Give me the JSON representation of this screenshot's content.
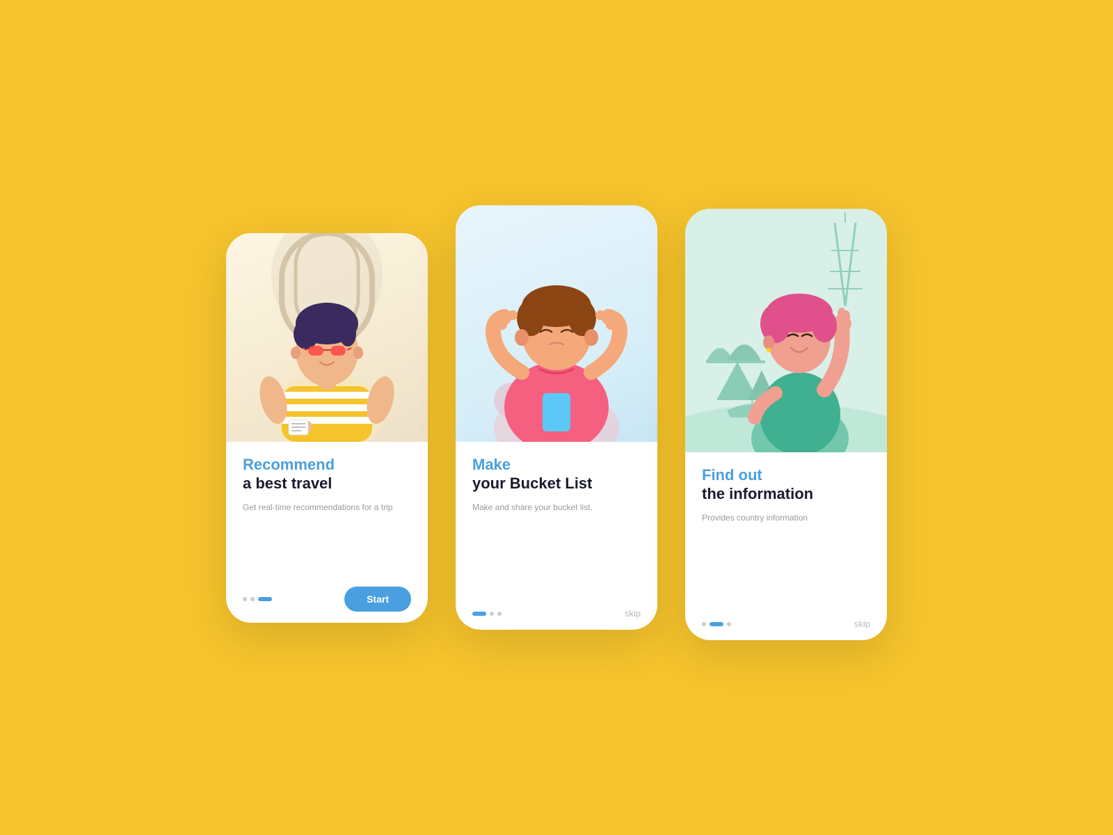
{
  "background_color": "#F5C32C",
  "cards": [
    {
      "id": "card-1",
      "title_colored": "Recommend",
      "title_black": "a best travel",
      "description": "Get real-time recommendations for a trip",
      "button_label": "Start",
      "dots": [
        "active",
        "dot",
        "dot"
      ],
      "show_skip": false,
      "show_button": true
    },
    {
      "id": "card-2",
      "title_colored": "Make",
      "title_black": "your Bucket List",
      "description": "Make and share your bucket list.",
      "skip_label": "skip",
      "dots": [
        "active",
        "dot",
        "dot"
      ],
      "show_skip": true,
      "show_button": false
    },
    {
      "id": "card-3",
      "title_colored": "Find out",
      "title_black": "the information",
      "description": "Provides country information",
      "skip_label": "skip",
      "dots": [
        "dot",
        "active",
        "dot"
      ],
      "show_skip": true,
      "show_button": false
    }
  ]
}
